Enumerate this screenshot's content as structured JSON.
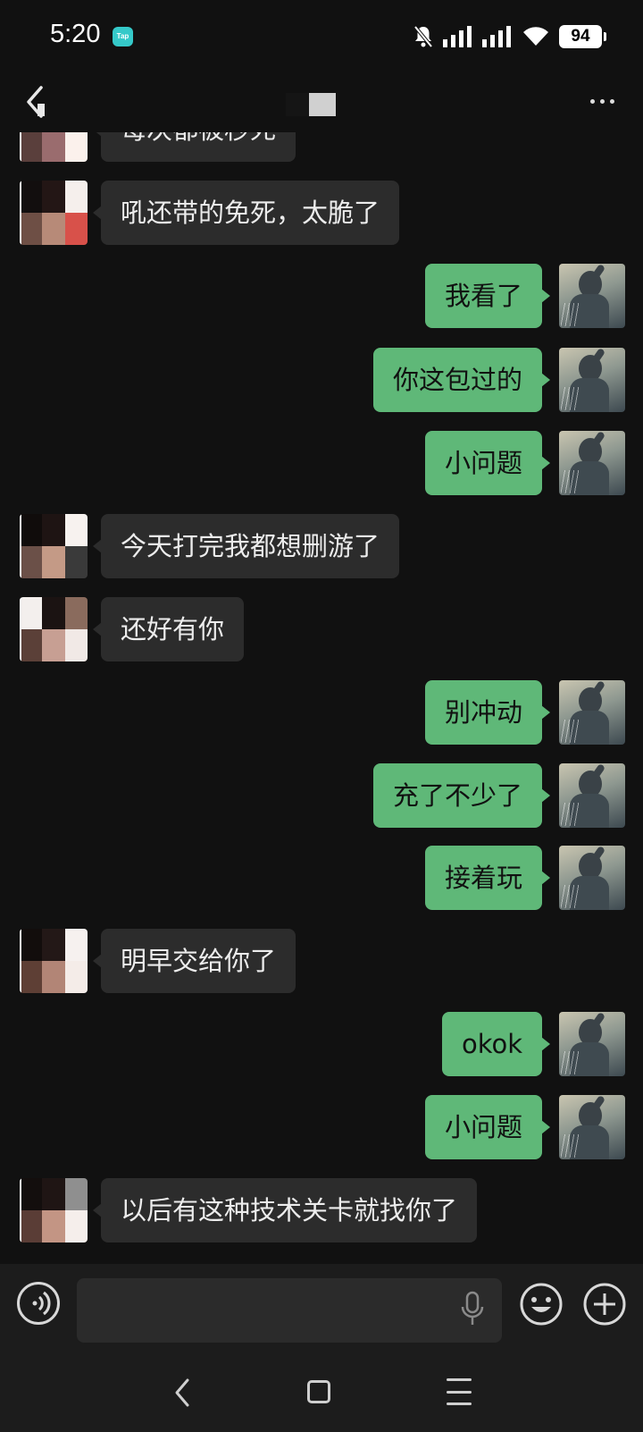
{
  "status_bar": {
    "time": "5:20",
    "app_badge": "Tap",
    "battery": "94"
  },
  "header": {
    "title": ""
  },
  "messages": [
    {
      "side": "in",
      "text": "每次都被秒死"
    },
    {
      "side": "in",
      "text": "吼还带的免死，太脆了"
    },
    {
      "side": "out",
      "text": "我看了"
    },
    {
      "side": "out",
      "text": "你这包过的"
    },
    {
      "side": "out",
      "text": "小问题"
    },
    {
      "side": "in",
      "text": "今天打完我都想删游了"
    },
    {
      "side": "in",
      "text": "还好有你"
    },
    {
      "side": "out",
      "text": "别冲动"
    },
    {
      "side": "out",
      "text": "充了不少了"
    },
    {
      "side": "out",
      "text": "接着玩"
    },
    {
      "side": "in",
      "text": "明早交给你了"
    },
    {
      "side": "out",
      "text": "okok"
    },
    {
      "side": "out",
      "text": "小问题"
    },
    {
      "side": "in",
      "text": "以后有这种技术关卡就找你了"
    }
  ],
  "input": {
    "placeholder": "",
    "value": ""
  },
  "colors": {
    "background": "#111111",
    "incoming_bubble": "#2c2c2c",
    "outgoing_bubble": "#5fb878",
    "input_bar": "#1c1c1c"
  },
  "icons": [
    "back-icon",
    "more-icon",
    "voice-icon",
    "mic-icon",
    "emoji-icon",
    "plus-icon",
    "nav-back-icon",
    "nav-home-icon",
    "nav-menu-icon"
  ]
}
